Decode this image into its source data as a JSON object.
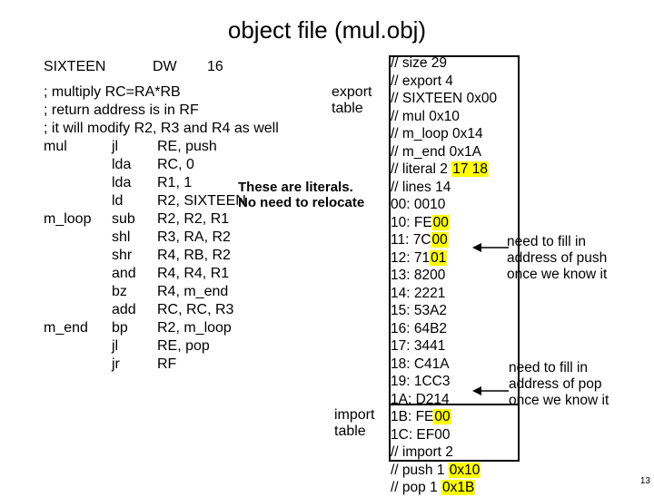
{
  "title": "object file (mul.obj)",
  "asm": {
    "firstline": {
      "label": "SIXTEEN",
      "op": "DW",
      "arg": "16"
    },
    "comments": [
      "; multiply RC=RA*RB",
      "; return address is in RF",
      "; it will modify R2, R3 and R4 as well"
    ],
    "rows": [
      {
        "label": "mul",
        "op": "jl",
        "arg": "RE, push"
      },
      {
        "label": "",
        "op": "lda",
        "arg": "RC, 0"
      },
      {
        "label": "",
        "op": "lda",
        "arg": "R1, 1"
      },
      {
        "label": "",
        "op": "ld",
        "arg": "R2, SIXTEEN"
      },
      {
        "label": "m_loop",
        "op": "sub",
        "arg": "R2, R2, R1"
      },
      {
        "label": "",
        "op": "shl",
        "arg": "R3, RA, R2"
      },
      {
        "label": "",
        "op": "shr",
        "arg": "R4, RB, R2"
      },
      {
        "label": "",
        "op": "and",
        "arg": "R4, R4, R1"
      },
      {
        "label": "",
        "op": "bz",
        "arg": "R4, m_end"
      },
      {
        "label": "",
        "op": "add",
        "arg": "RC, RC, R3"
      },
      {
        "label": "m_end",
        "op": "bp",
        "arg": "R2, m_loop"
      },
      {
        "label": "",
        "op": "",
        "arg": ""
      },
      {
        "label": "",
        "op": "jl",
        "arg": "RE, pop"
      },
      {
        "label": "",
        "op": "jr",
        "arg": "RF"
      }
    ]
  },
  "export_label1": "export",
  "export_label2": "table",
  "import_label1": "import",
  "import_label2": "table",
  "literals1": "These are literals.",
  "literals2": "No need to relocate",
  "sidebar": {
    "lines": [
      "// size 29",
      "// export 4",
      "// SIXTEEN 0x00",
      "// mul 0x10",
      "// m_loop 0x14",
      "// m_end 0x1A"
    ],
    "literal_prefix": "// literal 2 ",
    "literal_hl": "17 18",
    "lines2": [
      "// lines 14",
      "00: 0010"
    ],
    "row10a": "10: FE",
    "row10b": "00",
    "row11a": "11: 7C",
    "row11b": "00",
    "row12a": "12: 71",
    "row12b": "01",
    "lines3": [
      "13: 8200",
      "14: 2221",
      "15: 53A2",
      "16: 64B2",
      "17: 3441",
      "18: C41A",
      "19: 1CC3",
      "1A: D214"
    ],
    "row1Ba": "1B: FE",
    "row1Bb": "00",
    "row1C": "1C: EF00",
    "import_lines": [
      "// import 2"
    ],
    "push_a": "// push 1 ",
    "push_b": "0x10",
    "pop_a": "// pop 1 ",
    "pop_b": "0x1B"
  },
  "note1a": "need to fill in",
  "note1b": "address of push",
  "note1c": "once we know it",
  "note2a": "need to fill in",
  "note2b": "address of pop",
  "note2c": "once we know it",
  "pagenum": "13",
  "chart_data": null
}
